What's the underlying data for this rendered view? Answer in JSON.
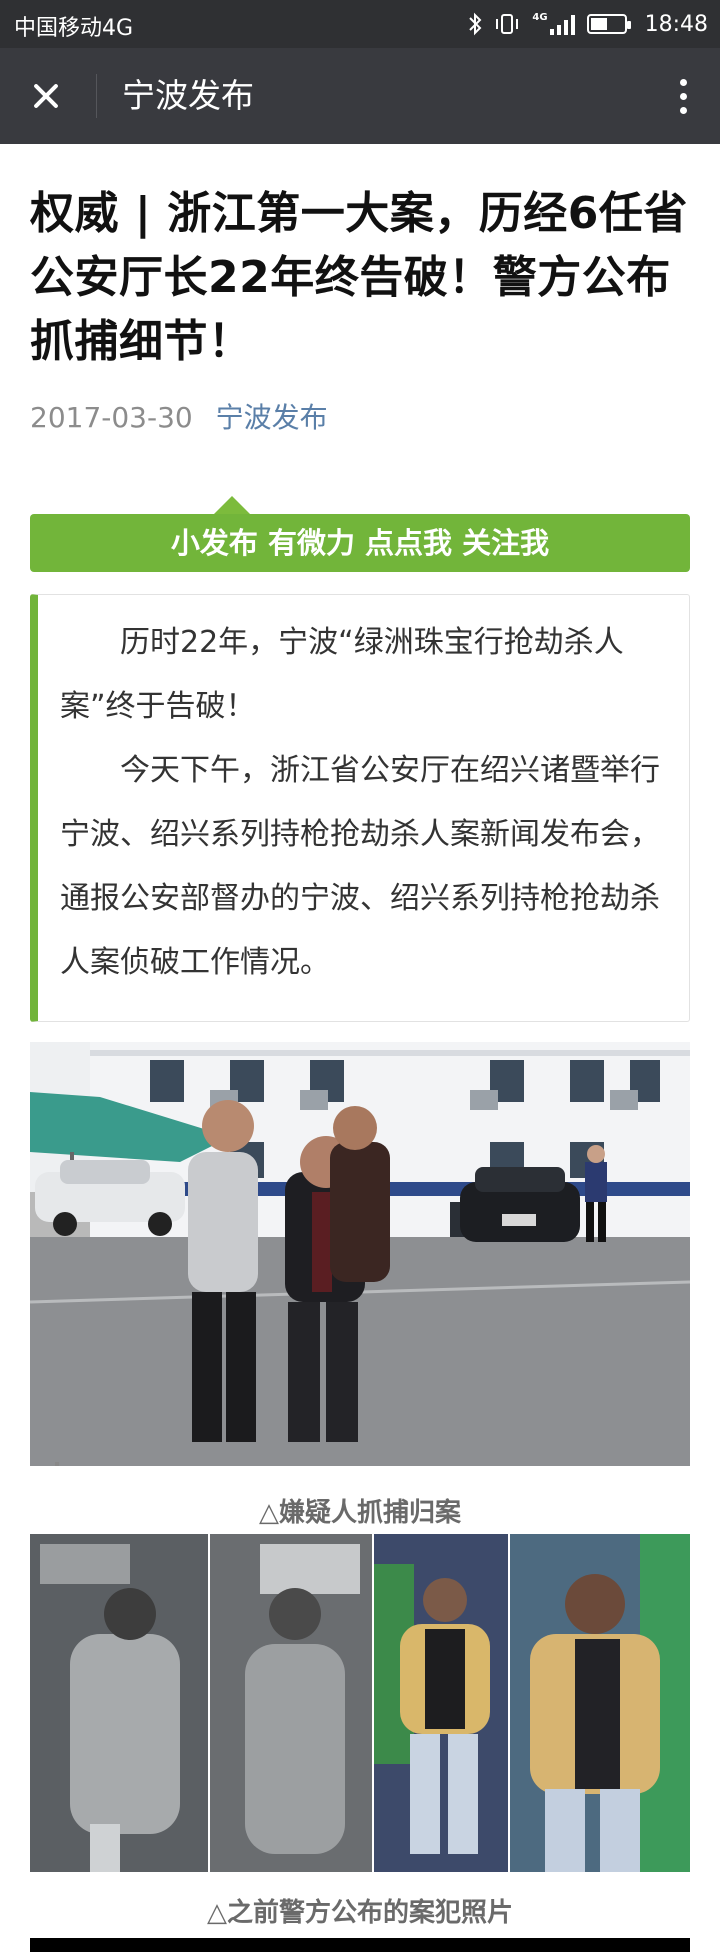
{
  "status_bar": {
    "carrier": "中国移动4G",
    "network_badge": "4G",
    "time": "18:48",
    "icons": [
      "bluetooth-icon",
      "vibrate-icon",
      "signal-icon",
      "battery-icon"
    ],
    "battery_level": 0.5
  },
  "nav": {
    "title": "宁波发布",
    "close_icon": "close-icon",
    "more_icon": "more-vertical-icon"
  },
  "article": {
    "title": "权威 | 浙江第一大案，历经6任省公安厅长22年终告破！警方公布抓捕细节！",
    "date": "2017-03-30",
    "author": "宁波发布",
    "follow_banner": "小发布 有微力 点点我 关注我",
    "intro_paragraphs": [
      "历时22年，宁波“绿洲珠宝行抢劫杀人案”终于告破！",
      "今天下午，浙江省公安厅在绍兴诸暨举行宁波、绍兴系列持枪抢劫杀人案新闻发布会，通报公安部督办的宁波、绍兴系列持枪抢劫杀人案侦破工作情况。"
    ],
    "photo1_caption": "△嫌疑人抓捕归案",
    "photo2_caption": "△之前警方公布的案犯照片"
  },
  "colors": {
    "status_bar_bg": "#2f3033",
    "nav_bg": "#393a3f",
    "accent_green": "#72b53a",
    "author_link": "#5a7fa8"
  }
}
